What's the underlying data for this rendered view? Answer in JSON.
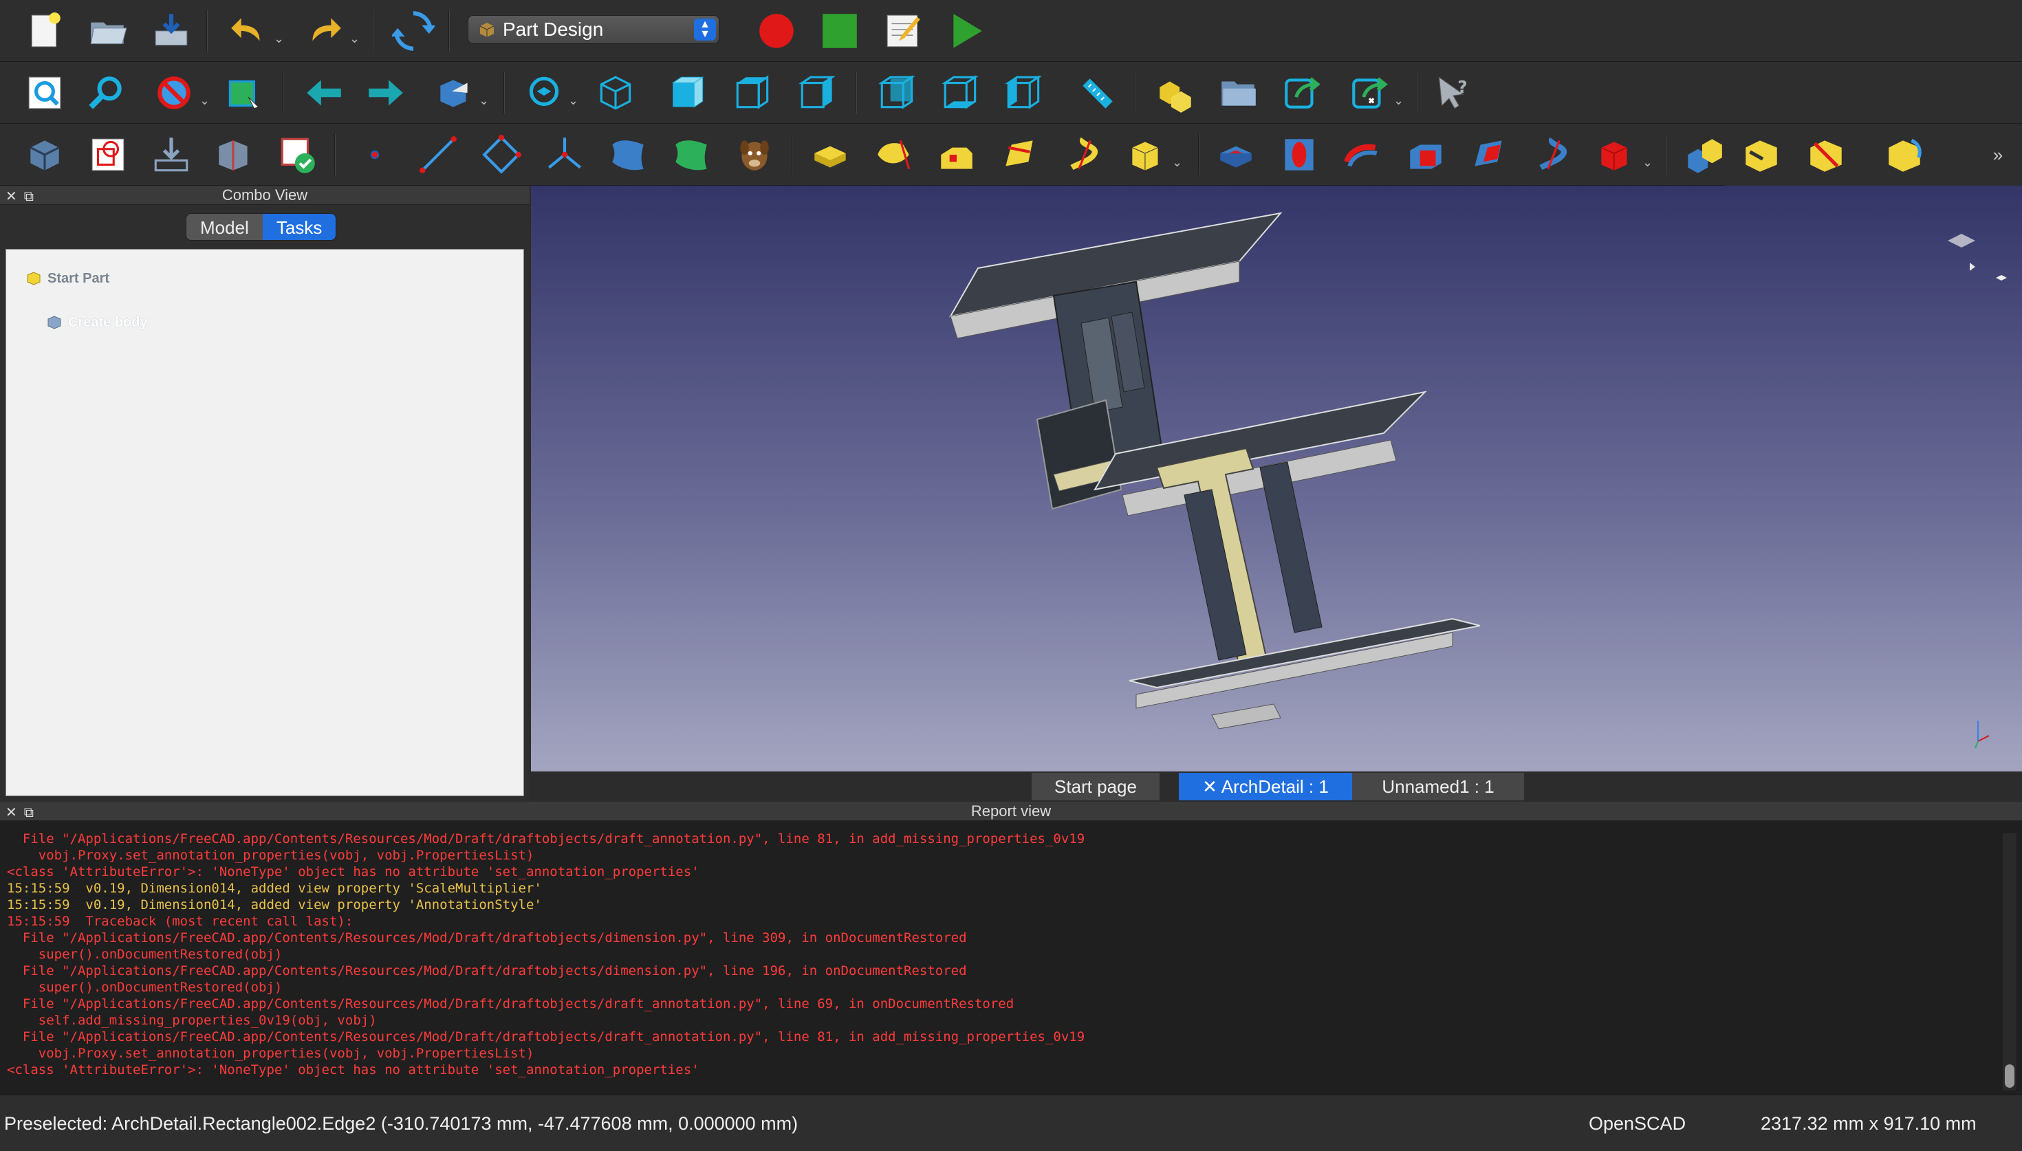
{
  "app": {
    "name": "FreeCAD"
  },
  "toolbar": {
    "workbench": "Part Design",
    "workbench_icon": "part-design-icon"
  },
  "combo_view": {
    "title": "Combo View",
    "tabs": [
      {
        "label": "Model",
        "active": false
      },
      {
        "label": "Tasks",
        "active": true
      }
    ],
    "task_title": "Start Part",
    "task_item": "Create body"
  },
  "doc_tabs": [
    {
      "label": "Start page",
      "active": false,
      "closable": false
    },
    {
      "label": "ArchDetail : 1",
      "active": true,
      "closable": true
    },
    {
      "label": "Unnamed1 : 1",
      "active": false,
      "closable": false
    }
  ],
  "report_view": {
    "title": "Report view",
    "lines": [
      {
        "type": "err",
        "text": "  File \"/Applications/FreeCAD.app/Contents/Resources/Mod/Draft/draftobjects/draft_annotation.py\", line 81, in add_missing_properties_0v19"
      },
      {
        "type": "err",
        "text": "    vobj.Proxy.set_annotation_properties(vobj, vobj.PropertiesList)"
      },
      {
        "type": "err",
        "text": "<class 'AttributeError'>: 'NoneType' object has no attribute 'set_annotation_properties'"
      },
      {
        "type": "log",
        "text": "15:15:59  v0.19, Dimension014, added view property 'ScaleMultiplier'"
      },
      {
        "type": "log",
        "text": "15:15:59  v0.19, Dimension014, added view property 'AnnotationStyle'"
      },
      {
        "type": "err",
        "text": "15:15:59  Traceback (most recent call last):"
      },
      {
        "type": "err",
        "text": "  File \"/Applications/FreeCAD.app/Contents/Resources/Mod/Draft/draftobjects/dimension.py\", line 309, in onDocumentRestored"
      },
      {
        "type": "err",
        "text": "    super().onDocumentRestored(obj)"
      },
      {
        "type": "err",
        "text": "  File \"/Applications/FreeCAD.app/Contents/Resources/Mod/Draft/draftobjects/dimension.py\", line 196, in onDocumentRestored"
      },
      {
        "type": "err",
        "text": "    super().onDocumentRestored(obj)"
      },
      {
        "type": "err",
        "text": "  File \"/Applications/FreeCAD.app/Contents/Resources/Mod/Draft/draftobjects/draft_annotation.py\", line 69, in onDocumentRestored"
      },
      {
        "type": "err",
        "text": "    self.add_missing_properties_0v19(obj, vobj)"
      },
      {
        "type": "err",
        "text": "  File \"/Applications/FreeCAD.app/Contents/Resources/Mod/Draft/draftobjects/draft_annotation.py\", line 81, in add_missing_properties_0v19"
      },
      {
        "type": "err",
        "text": "    vobj.Proxy.set_annotation_properties(vobj, vobj.PropertiesList)"
      },
      {
        "type": "err",
        "text": "<class 'AttributeError'>: 'NoneType' object has no attribute 'set_annotation_properties'"
      }
    ]
  },
  "status_bar": {
    "message": "Preselected: ArchDetail.Rectangle002.Edge2 (-310.740173 mm, -47.477608 mm, 0.000000 mm)",
    "navigation_style": "OpenSCAD",
    "dimensions": "2317.32 mm x 917.10 mm"
  },
  "colors": {
    "accent": "#1f6fe0",
    "error_text": "#ff3b3b",
    "log_text": "#e8c14a",
    "viewport_top": "#333568",
    "viewport_bottom": "#a3a5c0"
  }
}
